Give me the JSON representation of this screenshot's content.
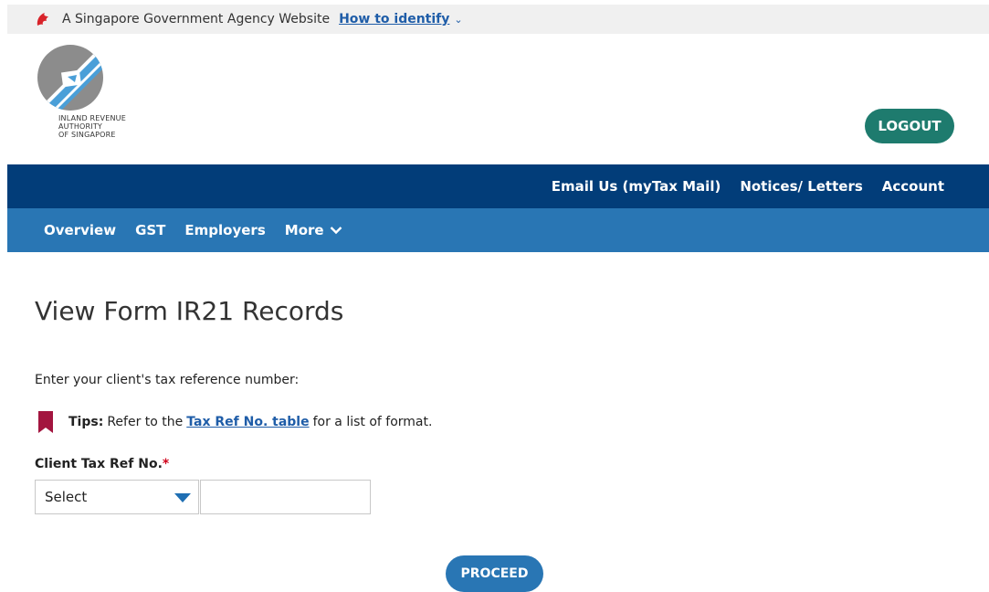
{
  "masthead": {
    "gov_text": "A Singapore Government Agency Website",
    "identify_link": "How to identify",
    "chevron": "⌄"
  },
  "logo": {
    "line1": "INLAND REVENUE",
    "line2": "AUTHORITY",
    "line3": "OF SINGAPORE",
    "icon": "iras-logo-icon"
  },
  "header": {
    "logout_label": "LOGOUT"
  },
  "top_nav": {
    "items": [
      "Email Us (myTax Mail)",
      "Notices/ Letters",
      "Account"
    ]
  },
  "sub_nav": {
    "items": [
      "Overview",
      "GST",
      "Employers",
      "More"
    ]
  },
  "main": {
    "title": "View Form IR21 Records",
    "instruction": "Enter your client's tax reference number:",
    "tips_label": "Tips:",
    "tips_before": "Refer to the",
    "tips_link": "Tax Ref No. table",
    "tips_after": "for a list of format.",
    "field_label": "Client Tax Ref No.",
    "required_mark": "*",
    "select_value": "Select",
    "input_value": "",
    "proceed_label": "PROCEED"
  },
  "colors": {
    "top_nav_bg": "#023d79",
    "sub_nav_bg": "#2976b4",
    "logout_bg": "#1e7b6e",
    "link": "#1f5da8",
    "bookmark": "#a3153f"
  }
}
